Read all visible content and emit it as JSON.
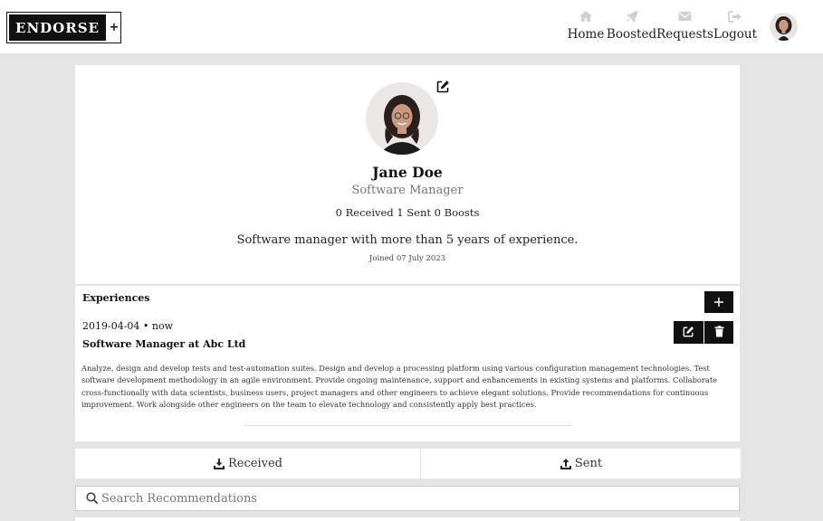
{
  "brand": {
    "name": "ENDORSE",
    "plus": "+"
  },
  "nav": {
    "items": [
      {
        "label": "Home",
        "icon": "home-icon"
      },
      {
        "label": "Boosted",
        "icon": "rocket-icon"
      },
      {
        "label": "Requests",
        "icon": "envelope-icon"
      },
      {
        "label": "Logout",
        "icon": "sign-out-icon"
      }
    ]
  },
  "profile": {
    "name": "Jane Doe",
    "title": "Software Manager",
    "stats": "0 Received 1 Sent 0 Boosts",
    "bio": "Software manager with more than 5 years of experience.",
    "joined": "Joined 07 July 2023"
  },
  "experiences": {
    "heading": "Experiences",
    "add_label": "+",
    "items": [
      {
        "dates": "2019-04-04 • now",
        "role": "Software Manager at Abc Ltd",
        "description": "Analyze, design and develop tests and test-automation suites. Design and develop a processing platform using various configuration management technologies. Test software development methodology in an agile environment. Provide ongoing maintenance, support and enhancements in existing systems and platforms. Collaborate cross-functionally with data scientists, business users, project managers and other engineers to achieve elegant solutions. Provide recommendations for continuous improvement. Work alongside other engineers on the team to elevate technology and consistently apply best practices."
      }
    ]
  },
  "tabs": {
    "received": "Received",
    "sent": "Sent"
  },
  "search": {
    "placeholder": "Search Recommendations",
    "value": ""
  },
  "colors": {
    "dark": "#111111",
    "background": "#e4e4e4",
    "card": "#ffffff"
  }
}
